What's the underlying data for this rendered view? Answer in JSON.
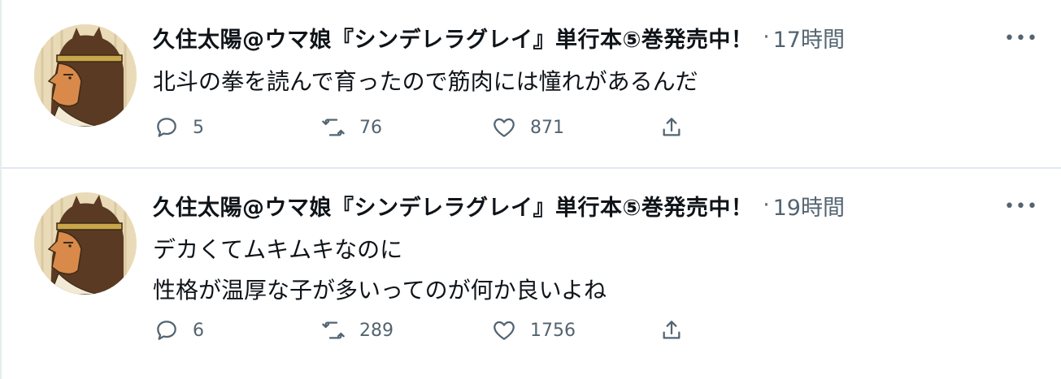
{
  "tweets": [
    {
      "display_name": "久住太陽@ウマ娘『シンデレラグレイ』単行本⑤巻発売中！",
      "separator": "·",
      "time": "17時間",
      "more_label": "•••",
      "lines": [
        "北斗の拳を読んで育ったので筋肉には憧れがあるんだ"
      ],
      "replies": "5",
      "retweets": "76",
      "likes": "871"
    },
    {
      "display_name": "久住太陽@ウマ娘『シンデレラグレイ』単行本⑤巻発売中！",
      "separator": "·",
      "time": "19時間",
      "more_label": "•••",
      "lines": [
        "デカくてムキムキなのに",
        "性格が温厚な子が多いってのが何か良いよね"
      ],
      "replies": "6",
      "retweets": "289",
      "likes": "1756"
    }
  ],
  "icons": {
    "reply": "reply-icon",
    "retweet": "retweet-icon",
    "like": "heart-icon",
    "share": "share-icon",
    "more": "more-icon"
  },
  "colors": {
    "text": "#0f1419",
    "secondary": "#536471",
    "divider": "#e1e8ed"
  }
}
